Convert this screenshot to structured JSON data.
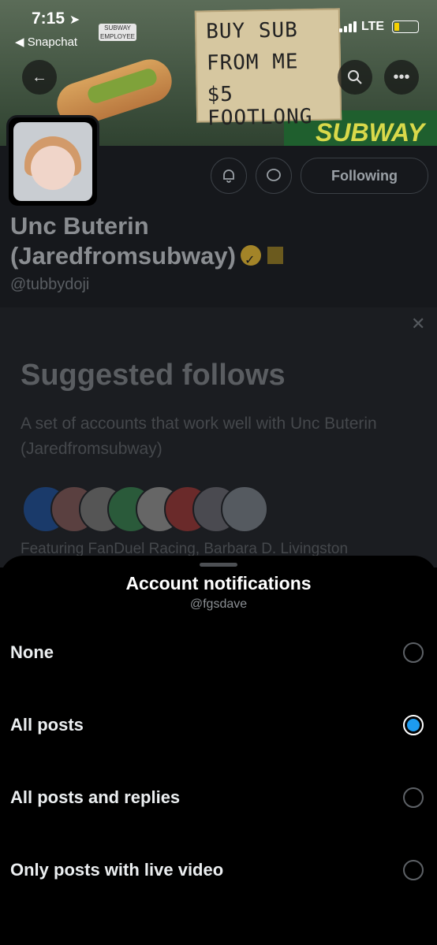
{
  "status_bar": {
    "time": "7:15",
    "back_app": "◀ Snapchat",
    "network": "LTE",
    "battery_level": 0.2
  },
  "banner": {
    "sign_lines": [
      "BUY SUB",
      "FROM ME",
      "$5 FOOTLONG"
    ],
    "badge_text": "SUBWAY EMPLOYEE",
    "brand_text": "SUBWAY"
  },
  "profile": {
    "display_name_line1": "Unc Buterin",
    "display_name_line2": "(Jaredfromsubway)",
    "handle": "@tubbydoji",
    "following_label": "Following"
  },
  "suggested": {
    "title": "Suggested follows",
    "description": "A set of accounts that work well with Unc Buterin (Jaredfromsubway)",
    "featuring_text": "Featuring FanDuel Racing, Barbara D. Livingston"
  },
  "sheet": {
    "title": "Account notifications",
    "subtitle": "@fgsdave",
    "options": [
      {
        "label": "None",
        "selected": false
      },
      {
        "label": "All posts",
        "selected": true
      },
      {
        "label": "All posts and replies",
        "selected": false
      },
      {
        "label": "Only posts with live video",
        "selected": false
      }
    ]
  },
  "colors": {
    "accent": "#1d9bf0",
    "sheet_bg": "#000000",
    "verified": "#a38428"
  }
}
